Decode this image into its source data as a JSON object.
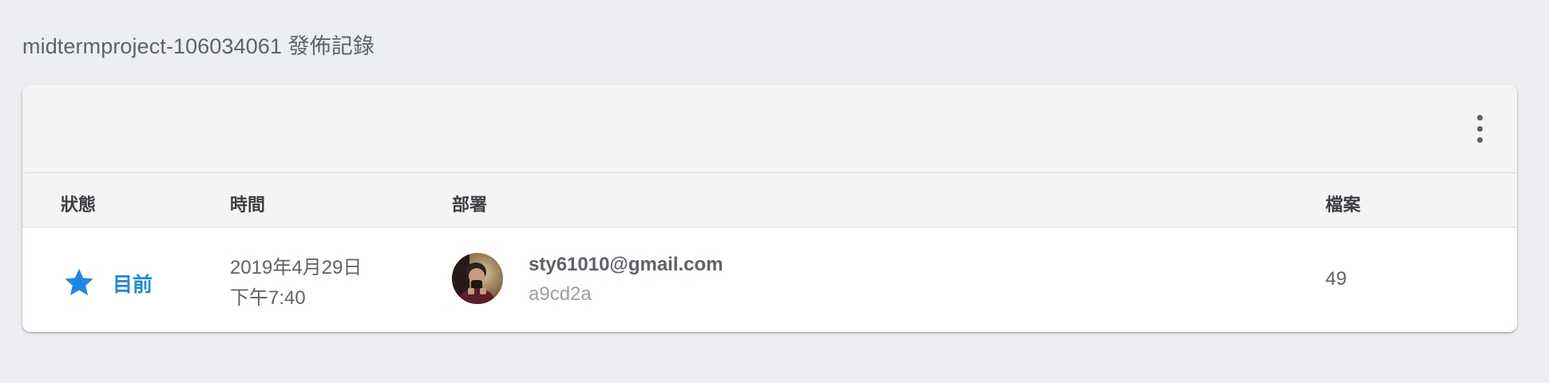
{
  "page": {
    "title": "midtermproject-106034061 發佈記錄"
  },
  "toolbar": {
    "more_icon": "more-vert-icon"
  },
  "table": {
    "headers": {
      "status": "狀態",
      "time": "時間",
      "deployer": "部署",
      "files": "檔案"
    },
    "rows": [
      {
        "status_icon": "star-icon",
        "status": "目前",
        "date": "2019年4月29日",
        "time": "下午7:40",
        "deployer_email": "sty61010@gmail.com",
        "version_hash": "a9cd2a",
        "files": "49"
      }
    ]
  },
  "colors": {
    "accent": "#1e88e5",
    "background": "#eceef1",
    "card_header": "#f4f4f4",
    "text_primary": "#3c4043",
    "text_secondary": "#5f6368",
    "text_muted": "#9aa0a6"
  }
}
